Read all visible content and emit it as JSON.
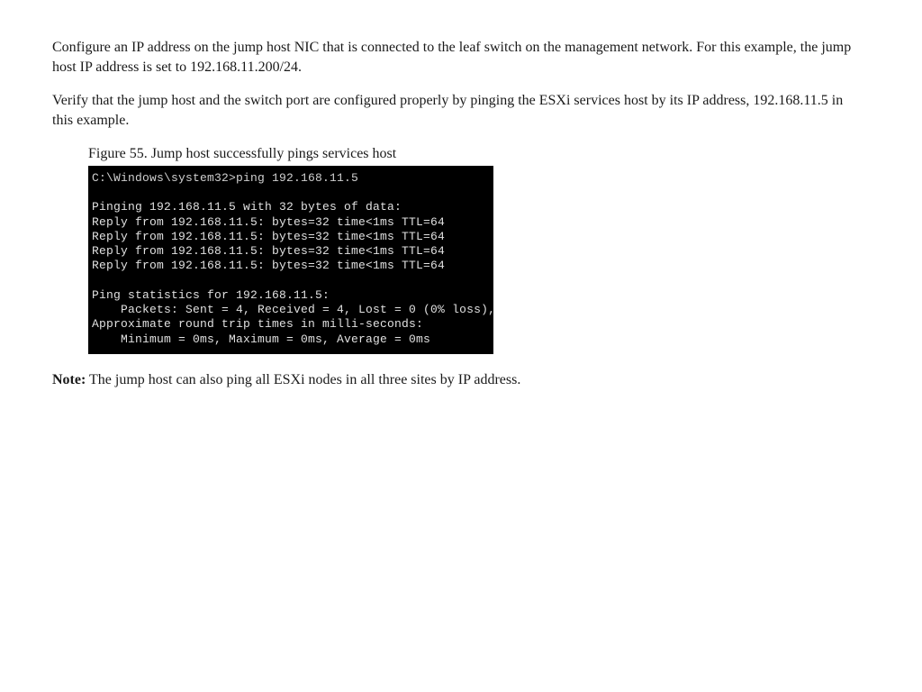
{
  "para1": "Configure an IP address on the jump host NIC that is connected to the leaf switch on the management network. For this example, the jump host IP address is set to 192.168.11.200/24.",
  "para2": "Verify that the jump host and the switch port are configured properly by pinging the ESXi services host by its IP address, 192.168.11.5 in this example.",
  "figure": {
    "caption": "Figure 55. Jump host successfully pings services host",
    "terminal": {
      "prompt": "C:\\Windows\\system32>ping 192.168.11.5",
      "blank1": "",
      "line1": "Pinging 192.168.11.5 with 32 bytes of data:",
      "reply1": "Reply from 192.168.11.5: bytes=32 time<1ms TTL=64",
      "reply2": "Reply from 192.168.11.5: bytes=32 time<1ms TTL=64",
      "reply3": "Reply from 192.168.11.5: bytes=32 time<1ms TTL=64",
      "reply4": "Reply from 192.168.11.5: bytes=32 time<1ms TTL=64",
      "blank2": "",
      "stats1": "Ping statistics for 192.168.11.5:",
      "stats2": "    Packets: Sent = 4, Received = 4, Lost = 0 (0% loss),",
      "stats3": "Approximate round trip times in milli-seconds:",
      "stats4": "    Minimum = 0ms, Maximum = 0ms, Average = 0ms"
    }
  },
  "note": {
    "label": "Note:",
    "text": " The jump host can also ping all ESXi nodes in all three sites by IP address."
  }
}
